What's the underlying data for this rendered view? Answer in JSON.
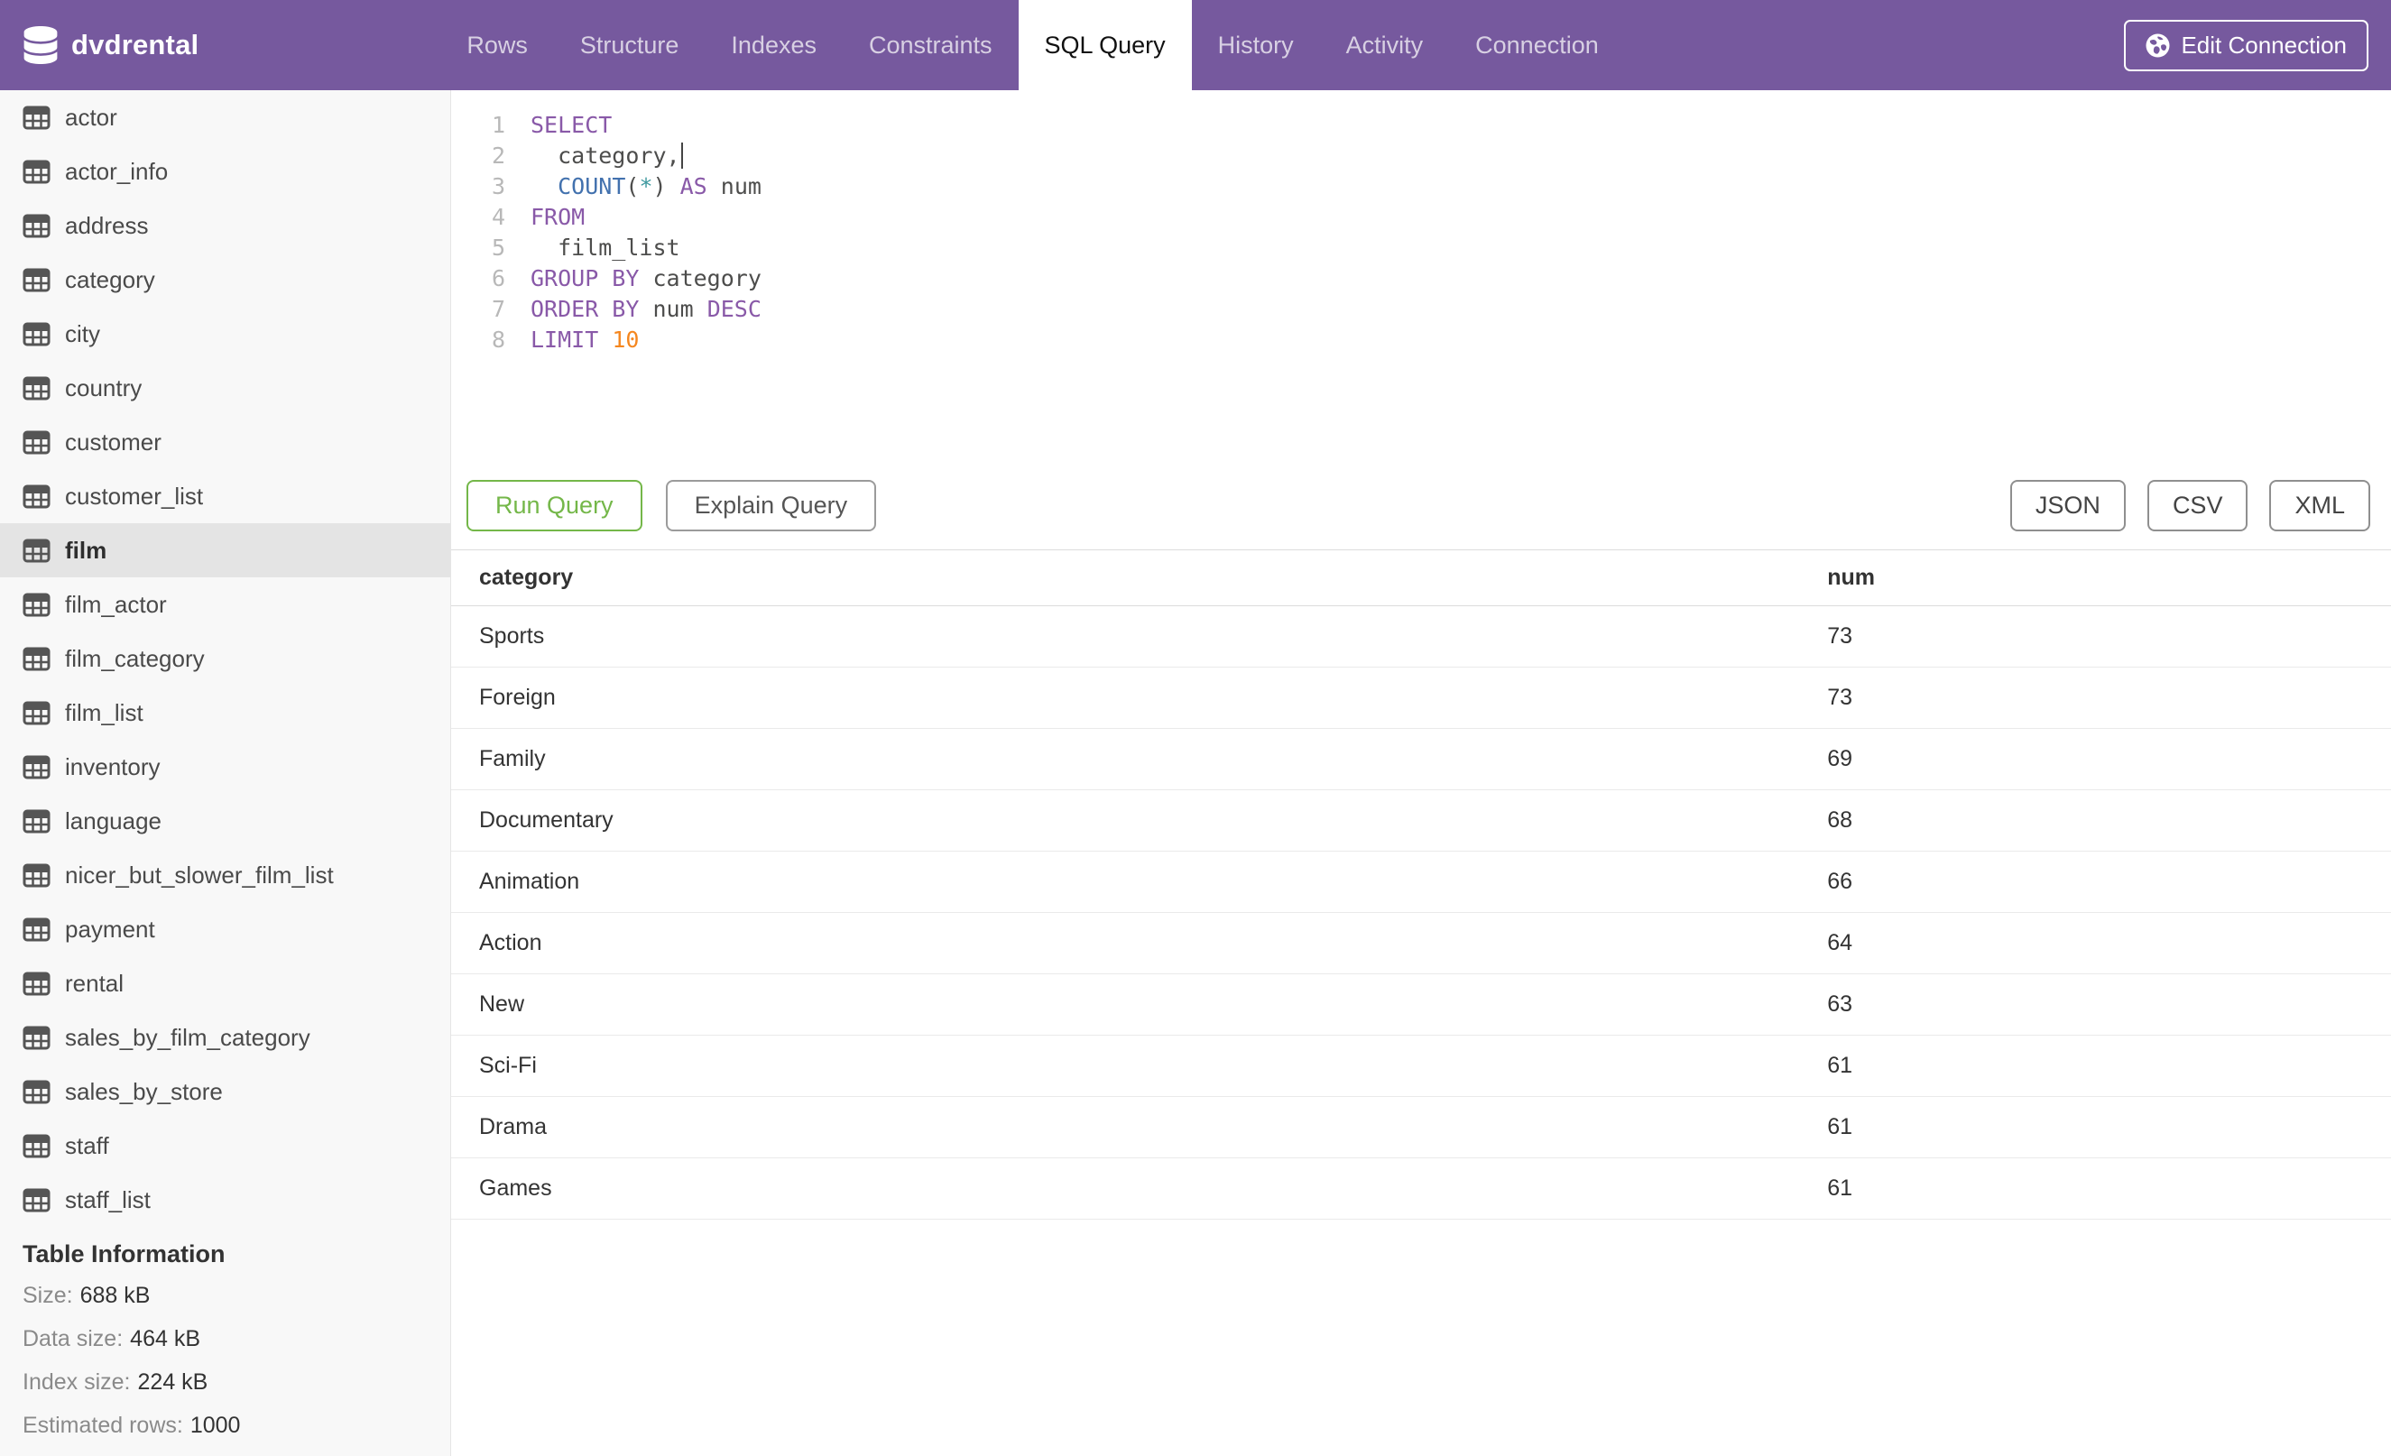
{
  "header": {
    "database_name": "dvdrental",
    "tabs": [
      {
        "label": "Rows",
        "active": false
      },
      {
        "label": "Structure",
        "active": false
      },
      {
        "label": "Indexes",
        "active": false
      },
      {
        "label": "Constraints",
        "active": false
      },
      {
        "label": "SQL Query",
        "active": true
      },
      {
        "label": "History",
        "active": false
      },
      {
        "label": "Activity",
        "active": false
      },
      {
        "label": "Connection",
        "active": false
      }
    ],
    "edit_connection_label": "Edit Connection"
  },
  "sidebar": {
    "tables": [
      "actor",
      "actor_info",
      "address",
      "category",
      "city",
      "country",
      "customer",
      "customer_list",
      "film",
      "film_actor",
      "film_category",
      "film_list",
      "inventory",
      "language",
      "nicer_but_slower_film_list",
      "payment",
      "rental",
      "sales_by_film_category",
      "sales_by_store",
      "staff",
      "staff_list"
    ],
    "selected_table": "film",
    "table_information": {
      "heading": "Table Information",
      "stats": [
        {
          "label": "Size:",
          "value": "688 kB"
        },
        {
          "label": "Data size:",
          "value": "464 kB"
        },
        {
          "label": "Index size:",
          "value": "224 kB"
        },
        {
          "label": "Estimated rows:",
          "value": "1000"
        }
      ]
    }
  },
  "editor": {
    "lines": [
      [
        [
          "keyword",
          "SELECT"
        ]
      ],
      [
        [
          "plain",
          "  category,"
        ],
        [
          "cursor",
          ""
        ]
      ],
      [
        [
          "plain",
          "  "
        ],
        [
          "builtin",
          "COUNT"
        ],
        [
          "plain",
          "("
        ],
        [
          "operator",
          "*"
        ],
        [
          "plain",
          ") "
        ],
        [
          "keyword",
          "AS"
        ],
        [
          "plain",
          " num"
        ]
      ],
      [
        [
          "keyword",
          "FROM"
        ]
      ],
      [
        [
          "plain",
          "  film_list"
        ]
      ],
      [
        [
          "keyword",
          "GROUP BY"
        ],
        [
          "plain",
          " category"
        ]
      ],
      [
        [
          "keyword",
          "ORDER BY"
        ],
        [
          "plain",
          " num "
        ],
        [
          "keyword",
          "DESC"
        ]
      ],
      [
        [
          "keyword",
          "LIMIT"
        ],
        [
          "plain",
          " "
        ],
        [
          "number",
          "10"
        ]
      ]
    ]
  },
  "actions": {
    "run_label": "Run Query",
    "explain_label": "Explain Query",
    "export_buttons": [
      "JSON",
      "CSV",
      "XML"
    ]
  },
  "results": {
    "columns": [
      "category",
      "num"
    ],
    "rows": [
      {
        "category": "Sports",
        "num": "73"
      },
      {
        "category": "Foreign",
        "num": "73"
      },
      {
        "category": "Family",
        "num": "69"
      },
      {
        "category": "Documentary",
        "num": "68"
      },
      {
        "category": "Animation",
        "num": "66"
      },
      {
        "category": "Action",
        "num": "64"
      },
      {
        "category": "New",
        "num": "63"
      },
      {
        "category": "Sci-Fi",
        "num": "61"
      },
      {
        "category": "Drama",
        "num": "61"
      },
      {
        "category": "Games",
        "num": "61"
      }
    ]
  },
  "colors": {
    "brand_purple": "#76599E",
    "run_green": "#74B749",
    "syntax_keyword": "#8959A8",
    "syntax_builtin": "#4271AE",
    "syntax_operator": "#3E999F",
    "syntax_number": "#F5871F",
    "sidebar_selected_bg": "#E4E4E4"
  }
}
